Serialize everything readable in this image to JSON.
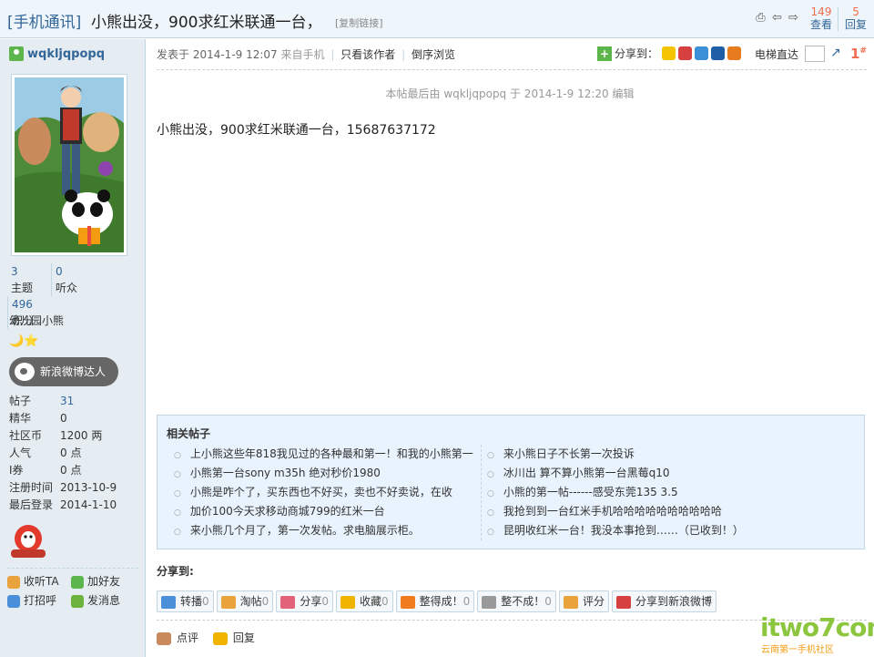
{
  "thread": {
    "category": "[手机通讯]",
    "title": "小熊出没，900求红米联通一台，",
    "copy_link": "[复制链接]",
    "views_count": "149",
    "views_label": "查看",
    "replies_count": "5",
    "replies_label": "回复"
  },
  "author": {
    "username": "wqkljqpopq",
    "stats": [
      {
        "value": "3",
        "label": "主题"
      },
      {
        "value": "0",
        "label": "听众"
      },
      {
        "value": "496",
        "label": "积分"
      }
    ],
    "group": "幼儿园小熊",
    "stars": "🌙⭐",
    "weibo_badge": "新浪微博达人",
    "profile": [
      {
        "key": "帖子",
        "value": "31"
      },
      {
        "key": "精华",
        "value": "0"
      },
      {
        "key": "社区币",
        "value": "1200 两"
      },
      {
        "key": "人气",
        "value": "0 点"
      },
      {
        "key": "I券",
        "value": "0 点"
      },
      {
        "key": "注册时间",
        "value": "2013-10-9"
      },
      {
        "key": "最后登录",
        "value": "2014-1-10"
      }
    ],
    "actions": [
      "收听TA",
      "加好友",
      "打招呼",
      "发消息"
    ]
  },
  "post": {
    "posted_prefix": "发表于 2014-1-9 12:07",
    "source": "来自手机",
    "only_author": "只看该作者",
    "reverse_order": "倒序浏览",
    "share_label": "分享到：",
    "elevator_label": "电梯直达",
    "floor": "1",
    "floor_sup": "#",
    "edit_note": "本帖最后由 wqkljqpopq 于 2014-1-9 12:20 编辑",
    "body": "小熊出没，900求红米联通一台，15687637172"
  },
  "related": {
    "title": "相关帖子",
    "left": [
      "上小熊这些年818我见过的各种最和第一！和我的小熊第一",
      "小熊第一台sony m35h 绝对秒价1980",
      "小熊是咋个了，买东西也不好买，卖也不好卖说，在收",
      "加价100今天求移动商城799的红米一台",
      "来小熊几个月了，第一次发帖。求电脑展示柜。"
    ],
    "right": [
      "来小熊日子不长第一次投诉",
      "冰川出 算不算小熊第一台黑莓q10",
      "小熊的第一帖------感受东莞135 3.5",
      "我抢到到一台红米手机哈哈哈哈哈哈哈哈哈哈",
      "昆明收红米一台！我没本事抢到……（已收到！）"
    ]
  },
  "share_bar": {
    "title": "分享到:",
    "buttons": [
      {
        "label": "转播",
        "count": "0",
        "color": "#4a90d9"
      },
      {
        "label": "淘帖",
        "count": "0",
        "color": "#e8a33d"
      },
      {
        "label": "分享",
        "count": "0",
        "color": "#e2627a"
      },
      {
        "label": "收藏",
        "count": "0",
        "color": "#f0b400"
      },
      {
        "label": "整得成！",
        "count": "0",
        "color": "#f07b1e"
      },
      {
        "label": "整不成！",
        "count": "0",
        "color": "#999999"
      },
      {
        "label": "评分",
        "count": "",
        "color": "#e8a33d"
      },
      {
        "label": "分享到新浪微博",
        "count": "",
        "color": "#d64040"
      }
    ]
  },
  "bottom_actions": [
    "点评",
    "回复"
  ],
  "watermark": {
    "main": "itwo7com",
    "sub": "云南第一手机社区"
  }
}
